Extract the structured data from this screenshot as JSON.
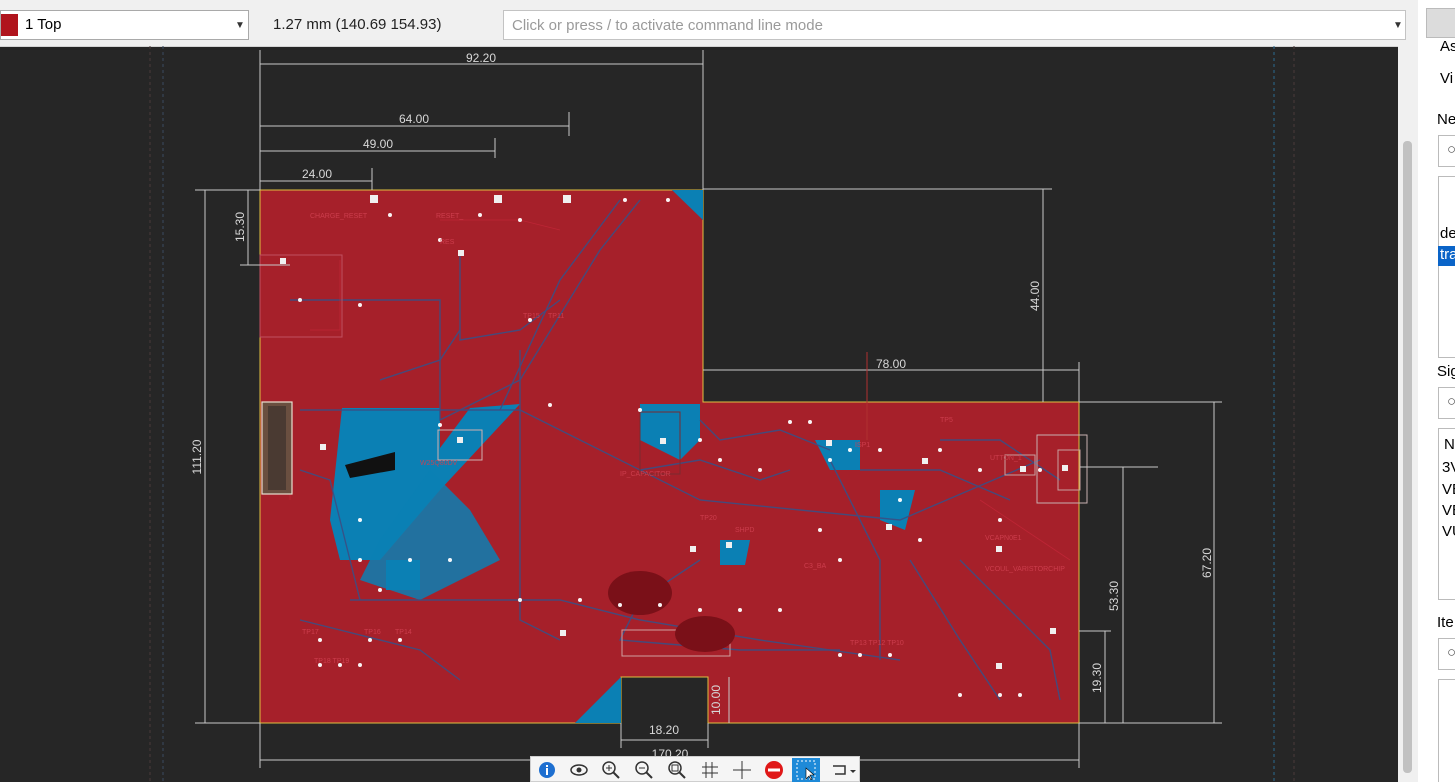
{
  "toolbar": {
    "layer": "1 Top",
    "layer_color": "#b0141c",
    "coordinates": "1.27 mm (140.69 154.93)",
    "command_placeholder": "Click or press / to activate command line mode"
  },
  "board": {
    "copper_color": "#a6202a",
    "pour_color": "#0b80b4",
    "outline_color": "#e0c040",
    "dimensions": [
      "92.20",
      "64.00",
      "49.00",
      "24.00",
      "15.30",
      "44.00",
      "78.00",
      "111.20",
      "67.20",
      "53.30",
      "19.30",
      "10.00",
      "18.20",
      "170.20"
    ]
  },
  "right_panel": {
    "labels": [
      "As",
      "Vi",
      "Ne",
      "de",
      "Sig",
      "N",
      "3V",
      "VE",
      "VE",
      "VU",
      "Ite"
    ],
    "selected": "tra"
  },
  "view_tools": [
    "info-icon",
    "eye-icon",
    "zoom-in-icon",
    "zoom-out-icon",
    "zoom-fit-icon",
    "grid-icon",
    "crosshair-icon",
    "stop-icon",
    "select-icon",
    "route-icon"
  ]
}
